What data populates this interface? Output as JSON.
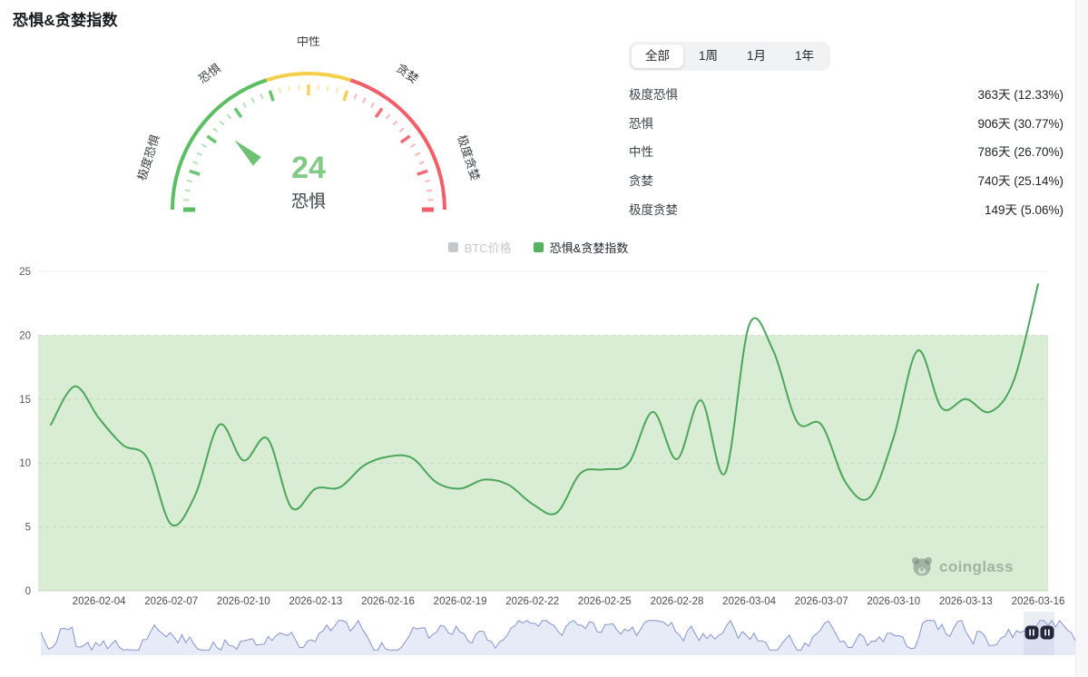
{
  "page": {
    "title": "恐惧&贪婪指数"
  },
  "tabs": {
    "items": [
      {
        "label": "全部",
        "active": true
      },
      {
        "label": "1周",
        "active": false
      },
      {
        "label": "1月",
        "active": false
      },
      {
        "label": "1年",
        "active": false
      }
    ]
  },
  "stats": {
    "rows": [
      {
        "label": "极度恐惧",
        "value": "363天 (12.33%)"
      },
      {
        "label": "恐惧",
        "value": "906天 (30.77%)"
      },
      {
        "label": "中性",
        "value": "786天 (26.70%)"
      },
      {
        "label": "贪婪",
        "value": "740天 (25.14%)"
      },
      {
        "label": "极度贪婪",
        "value": "149天 (5.06%)"
      }
    ]
  },
  "gauge": {
    "value": 24,
    "value_label": "恐惧",
    "value_color": "#82cb87",
    "needle_color": "#6cc272",
    "zones": [
      {
        "to": 40,
        "color": "#5abf63"
      },
      {
        "to": 60,
        "color": "#f3cf4c"
      },
      {
        "to": 100,
        "color": "#f15f6a"
      }
    ],
    "zone_labels": [
      {
        "label": "极度恐惧",
        "percent": 10
      },
      {
        "label": "恐惧",
        "percent": 30
      },
      {
        "label": "中性",
        "percent": 50
      },
      {
        "label": "贪婪",
        "percent": 70
      },
      {
        "label": "极度贪婪",
        "percent": 90
      }
    ]
  },
  "legend": {
    "items": [
      {
        "label": "BTC价格",
        "color": "#c6c9cc",
        "disabled": true
      },
      {
        "label": "恐惧&贪婪指数",
        "color": "#54b25f",
        "disabled": false
      }
    ]
  },
  "chart_data": {
    "type": "line",
    "title": "恐惧&贪婪指数",
    "ylim": [
      0,
      25
    ],
    "yticks": [
      0,
      5,
      10,
      15,
      20,
      25
    ],
    "xticks": [
      "2026-02-04",
      "2026-02-07",
      "2026-02-10",
      "2026-02-13",
      "2026-02-16",
      "2026-02-19",
      "2026-02-22",
      "2026-02-25",
      "2026-02-28",
      "2026-03-04",
      "2026-03-07",
      "2026-03-10",
      "2026-03-13",
      "2026-03-16"
    ],
    "band": {
      "from": 0,
      "to": 20,
      "color": "#d8edd3"
    },
    "grid": "dashed-horizontal",
    "legend_position": "top",
    "series": [
      {
        "name": "恐惧&贪婪指数",
        "color": "#4da65c",
        "smooth": true,
        "points": [
          [
            "2026-02-02",
            13
          ],
          [
            "2026-02-03",
            16
          ],
          [
            "2026-02-04",
            13.5
          ],
          [
            "2026-02-05",
            11.4
          ],
          [
            "2026-02-06",
            10.4
          ],
          [
            "2026-02-07",
            5.2
          ],
          [
            "2026-02-08",
            7.5
          ],
          [
            "2026-02-09",
            13
          ],
          [
            "2026-02-10",
            10.2
          ],
          [
            "2026-02-11",
            11.9
          ],
          [
            "2026-02-12",
            6.5
          ],
          [
            "2026-02-13",
            8
          ],
          [
            "2026-02-14",
            8.1
          ],
          [
            "2026-02-15",
            9.8
          ],
          [
            "2026-02-16",
            10.5
          ],
          [
            "2026-02-17",
            10.4
          ],
          [
            "2026-02-18",
            8.5
          ],
          [
            "2026-02-19",
            8
          ],
          [
            "2026-02-20",
            8.7
          ],
          [
            "2026-02-21",
            8.3
          ],
          [
            "2026-02-22",
            6.8
          ],
          [
            "2026-02-23",
            6.1
          ],
          [
            "2026-02-24",
            9.2
          ],
          [
            "2026-02-25",
            9.5
          ],
          [
            "2026-02-26",
            10
          ],
          [
            "2026-02-27",
            14
          ],
          [
            "2026-02-28",
            10.3
          ],
          [
            "2026-03-01",
            14.9
          ],
          [
            "2026-03-02",
            9.2
          ],
          [
            "2026-03-04",
            20.8
          ],
          [
            "2026-03-05",
            18.8
          ],
          [
            "2026-03-06",
            13.2
          ],
          [
            "2026-03-07",
            13
          ],
          [
            "2026-03-08",
            8.5
          ],
          [
            "2026-03-09",
            7.3
          ],
          [
            "2026-03-10",
            12
          ],
          [
            "2026-03-11",
            18.8
          ],
          [
            "2026-03-12",
            14.3
          ],
          [
            "2026-03-13",
            15
          ],
          [
            "2026-03-14",
            14
          ],
          [
            "2026-03-15",
            16.5
          ],
          [
            "2026-03-16",
            24
          ]
        ]
      },
      {
        "name": "BTC价格",
        "color": "#c6c9cc",
        "hidden": true
      }
    ],
    "navigator": {
      "label": "BTC价格",
      "seed": 20260316,
      "points": 265,
      "line_color": "#7b89c9",
      "fill_color": "#e7ebf8"
    }
  },
  "watermark": {
    "text": "coinglass"
  }
}
